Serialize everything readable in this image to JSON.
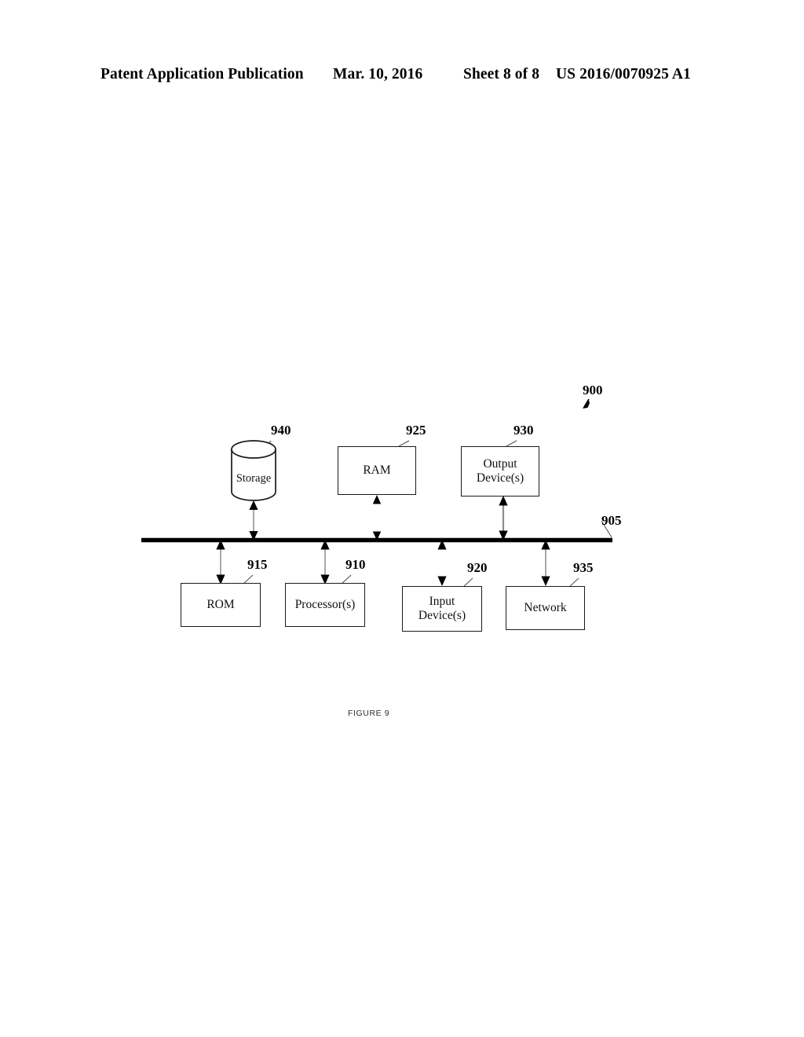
{
  "header": {
    "publication": "Patent Application Publication",
    "date": "Mar. 10, 2016",
    "sheet": "Sheet 8 of 8",
    "patent_number": "US 2016/0070925 A1"
  },
  "figure": {
    "caption": "FIGURE 9",
    "system_ref": "900",
    "bus_ref": "905",
    "colors": {
      "ink": "#000000",
      "box_stroke": "#1a1a1a",
      "connector": "#8c8c8c",
      "background": "#ffffff"
    },
    "nodes": [
      {
        "id": "storage",
        "label": "Storage",
        "ref": "940",
        "shape": "cylinder",
        "row": "top"
      },
      {
        "id": "ram",
        "label": "RAM",
        "ref": "925",
        "shape": "rect",
        "row": "top"
      },
      {
        "id": "output-devices",
        "label_line1": "Output",
        "label_line2": "Device(s)",
        "ref": "930",
        "shape": "rect",
        "row": "top"
      },
      {
        "id": "rom",
        "label": "ROM",
        "ref": "915",
        "shape": "rect",
        "row": "bottom"
      },
      {
        "id": "processors",
        "label": "Processor(s)",
        "ref": "910",
        "shape": "rect",
        "row": "bottom"
      },
      {
        "id": "input-devices",
        "label_line1": "Input",
        "label_line2": "Device(s)",
        "ref": "920",
        "shape": "rect",
        "row": "bottom"
      },
      {
        "id": "network",
        "label": "Network",
        "ref": "935",
        "shape": "rect",
        "row": "bottom"
      }
    ]
  }
}
